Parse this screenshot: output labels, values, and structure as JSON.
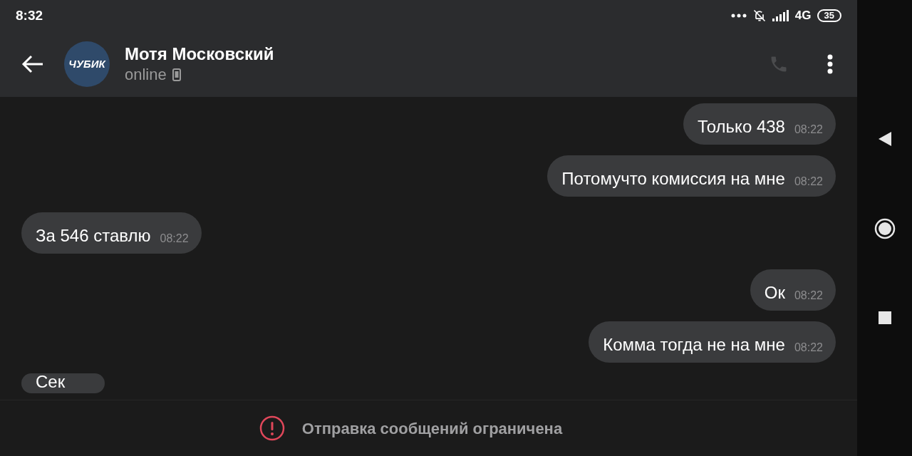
{
  "status_bar": {
    "time": "8:32",
    "network": "4G",
    "battery": "35"
  },
  "header": {
    "name": "Мотя Московский",
    "status": "online",
    "avatar_text": "ЧУБИК"
  },
  "messages": [
    {
      "text": "Только 438",
      "time": "08:22",
      "kind": "outgoing"
    },
    {
      "text": "Потомучто комиссия на мне",
      "time": "08:22",
      "kind": "outgoing"
    },
    {
      "text": "За 546 ставлю",
      "time": "08:22",
      "kind": "incoming"
    },
    {
      "text": "Ок",
      "time": "08:22",
      "kind": "outgoing"
    },
    {
      "text": "Комма тогда не на мне",
      "time": "08:22",
      "kind": "outgoing"
    },
    {
      "text": "Сек",
      "kind": "incoming"
    }
  ],
  "notice": "Отправка сообщений ограничена"
}
